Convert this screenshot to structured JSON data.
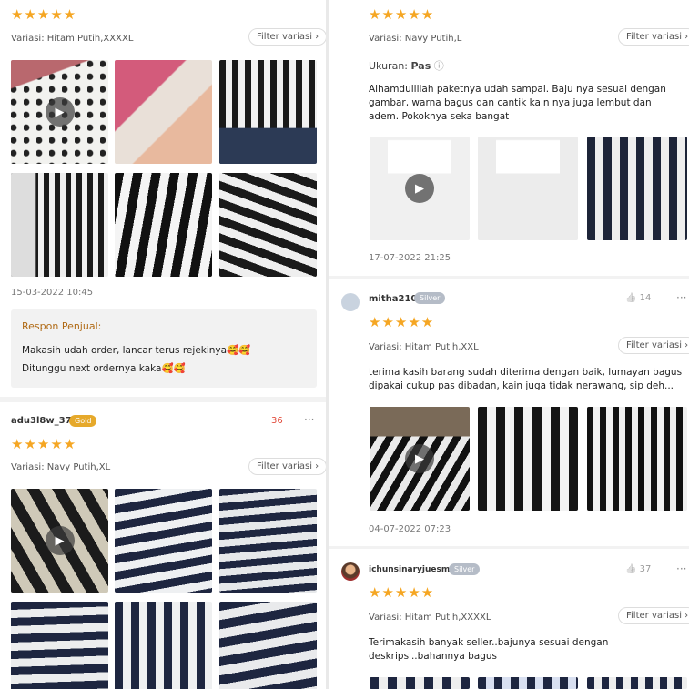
{
  "left": {
    "review1": {
      "stars": "★★★★★",
      "variasi": "Variasi: Hitam Putih,XXXXL",
      "filter_label": "Filter variasi ›",
      "date": "15-03-2022 10:45",
      "seller_response": {
        "title": "Respon Penjual:",
        "line1": "Makasih udah order, lancar terus rejekinya🥰🥰",
        "line2": "Ditunggu next ordernya kaka🥰🥰"
      }
    },
    "review2": {
      "username": "adu3l8w_37",
      "badge": "Gold",
      "likes": "36",
      "more": "···",
      "stars": "★★★★★",
      "variasi": "Variasi: Navy Putih,XL",
      "filter_label": "Filter variasi ›"
    }
  },
  "right": {
    "review1": {
      "stars": "★★★★★",
      "variasi": "Variasi: Navy Putih,L",
      "filter_label": "Filter variasi ›",
      "ukuran_label": "Ukuran:",
      "ukuran_value": "Pas",
      "info_icon": "ⓘ",
      "text": "Alhamdulillah paketnya udah sampai. Baju nya sesuai dengan gambar, warna bagus dan cantik kain nya juga lembut dan adem. Pokoknya seka bangat",
      "date": "17-07-2022 21:25"
    },
    "review2": {
      "username": "mitha210",
      "badge": "Silver",
      "likes": "14",
      "more": "···",
      "stars": "★★★★★",
      "variasi": "Variasi: Hitam Putih,XXL",
      "filter_label": "Filter variasi ›",
      "text": "terima kasih barang sudah diterima dengan baik, lumayan bagus dipakai cukup pas dibadan, kain juga tidak nerawang, sip deh...",
      "date": "04-07-2022 07:23"
    },
    "review3": {
      "username": "ichunsinaryjuesmi",
      "badge": "Silver",
      "likes": "37",
      "more": "···",
      "stars": "★★★★★",
      "variasi": "Variasi: Hitam Putih,XXXXL",
      "filter_label": "Filter variasi ›",
      "text": "Terimakasih banyak seller..bajunya sesuai dengan deskripsi..bahannya bagus"
    }
  },
  "icons": {
    "play": "▶",
    "thumbs_up": "👍"
  },
  "colors": {
    "star": "#f5a623",
    "gold_badge": "#e6a92b",
    "silver_badge": "#b5bcc7",
    "seller_title": "#b06a15",
    "likes_red": "#e24a3a"
  }
}
